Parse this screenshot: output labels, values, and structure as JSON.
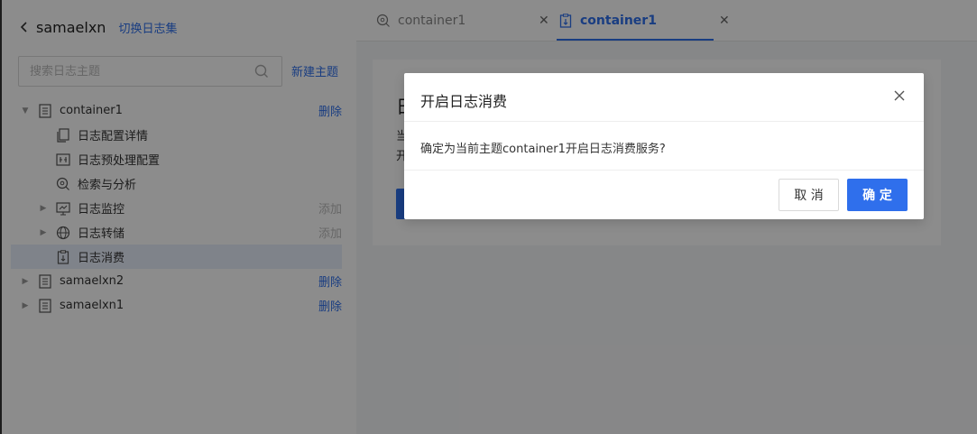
{
  "sidebar": {
    "workspace_name": "samaelxn",
    "switch_label": "切换日志集",
    "search_placeholder": "搜索日志主题",
    "new_topic_label": "新建主题",
    "tree": [
      {
        "label": "container1",
        "action": "删除"
      },
      {
        "label": "日志配置详情"
      },
      {
        "label": "日志预处理配置"
      },
      {
        "label": "检索与分析"
      },
      {
        "label": "日志监控",
        "action": "添加"
      },
      {
        "label": "日志转储",
        "action": "添加"
      },
      {
        "label": "日志消费"
      },
      {
        "label": "samaelxn2",
        "action": "删除"
      },
      {
        "label": "samaelxn1",
        "action": "删除"
      }
    ]
  },
  "tabs": [
    {
      "label": "container1",
      "icon": "search-analysis-icon"
    },
    {
      "label": "container1",
      "icon": "consume-icon",
      "active": true
    }
  ],
  "content": {
    "title": "日",
    "line1": "当",
    "line2": "开"
  },
  "modal": {
    "title": "开启日志消费",
    "message": "确定为当前主题container1开启日志消费服务?",
    "cancel_label": "取 消",
    "ok_label": "确 定"
  },
  "colors": {
    "accent": "#2f6fec",
    "overlay": "rgba(0,0,0,0.45)"
  }
}
